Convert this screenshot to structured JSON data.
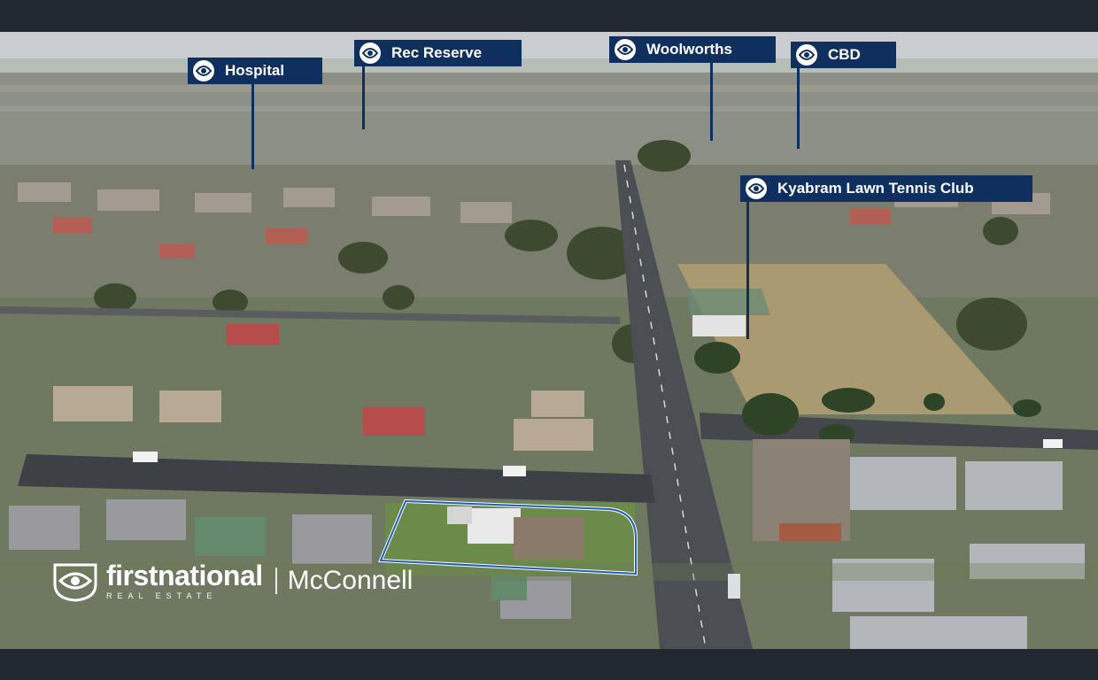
{
  "labels": {
    "hospital": "Hospital",
    "rec_reserve": "Rec Reserve",
    "woolworths": "Woolworths",
    "cbd": "CBD",
    "tennis_club": "Kyabram Lawn Tennis Club"
  },
  "branding": {
    "name": "firstnational",
    "subtitle": "REAL ESTATE",
    "office": "McConnell"
  },
  "colors": {
    "label_bg": "#0f2f5f",
    "frame": "#222831",
    "property_outline": "#1f5fb8"
  }
}
